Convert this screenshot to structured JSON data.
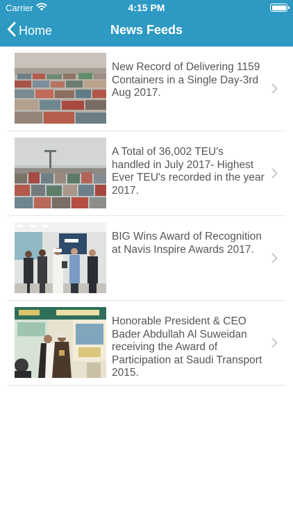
{
  "status_bar": {
    "carrier": "Carrier",
    "time": "4:15 PM"
  },
  "nav": {
    "back_label": "Home",
    "title": "News Feeds"
  },
  "colors": {
    "header_background": "#2e9ac4",
    "text": "#555555",
    "separator": "#e4e4e4",
    "chevron": "#c7c7cc"
  },
  "feed": {
    "items": [
      {
        "title": "New Record of Delivering 1159 Containers in a Single Day-3rd Aug 2017.",
        "image": "container-yard-photo"
      },
      {
        "title": "A Total of 36,002 TEU's handled in July 2017- Highest Ever TEU's recorded in the year 2017.",
        "image": "container-stacks-crane-photo"
      },
      {
        "title": "BIG Wins Award of Recognition at Navis Inspire Awards 2017.",
        "image": "award-group-photo"
      },
      {
        "title": "Honorable President & CEO Bader Abdullah Al Suweidan receiving the Award of Participation at Saudi Transport 2015.",
        "image": "award-ceremony-photo"
      }
    ]
  }
}
